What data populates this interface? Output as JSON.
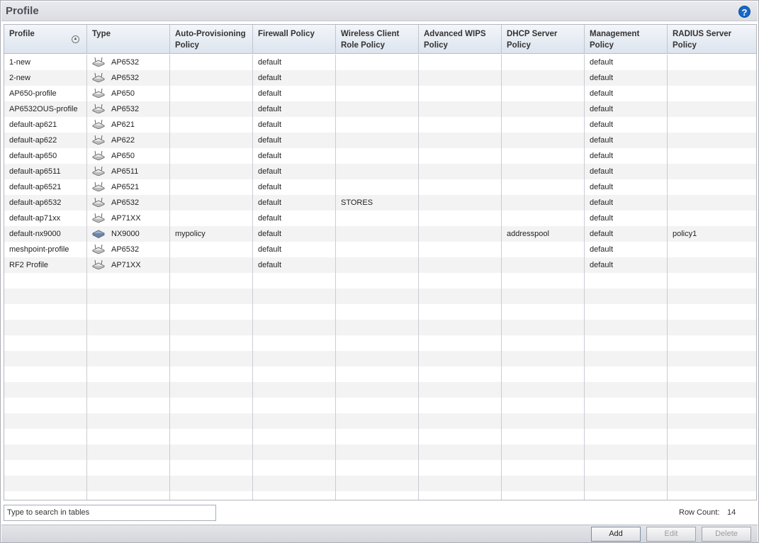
{
  "header": {
    "title": "Profile",
    "help_glyph": "?"
  },
  "table": {
    "columns": [
      "Profile",
      "Type",
      "Auto-Provisioning Policy",
      "Firewall Policy",
      "Wireless Client Role Policy",
      "Advanced WIPS Policy",
      "DHCP Server Policy",
      "Management Policy",
      "RADIUS Server Policy"
    ],
    "sort_glyph": "▲",
    "rows": [
      {
        "profile": "1-new",
        "type": "AP6532",
        "icon": "ap-icon",
        "auto": "",
        "firewall": "default",
        "wcrp": "",
        "wips": "",
        "dhcp": "",
        "mgmt": "default",
        "radius": ""
      },
      {
        "profile": "2-new",
        "type": "AP6532",
        "icon": "ap-icon",
        "auto": "",
        "firewall": "default",
        "wcrp": "",
        "wips": "",
        "dhcp": "",
        "mgmt": "default",
        "radius": ""
      },
      {
        "profile": "AP650-profile",
        "type": "AP650",
        "icon": "ap-icon",
        "auto": "",
        "firewall": "default",
        "wcrp": "",
        "wips": "",
        "dhcp": "",
        "mgmt": "default",
        "radius": ""
      },
      {
        "profile": "AP6532OUS-profile",
        "type": "AP6532",
        "icon": "ap-icon",
        "auto": "",
        "firewall": "default",
        "wcrp": "",
        "wips": "",
        "dhcp": "",
        "mgmt": "default",
        "radius": ""
      },
      {
        "profile": "default-ap621",
        "type": "AP621",
        "icon": "ap-icon",
        "auto": "",
        "firewall": "default",
        "wcrp": "",
        "wips": "",
        "dhcp": "",
        "mgmt": "default",
        "radius": ""
      },
      {
        "profile": "default-ap622",
        "type": "AP622",
        "icon": "ap-icon",
        "auto": "",
        "firewall": "default",
        "wcrp": "",
        "wips": "",
        "dhcp": "",
        "mgmt": "default",
        "radius": ""
      },
      {
        "profile": "default-ap650",
        "type": "AP650",
        "icon": "ap-icon",
        "auto": "",
        "firewall": "default",
        "wcrp": "",
        "wips": "",
        "dhcp": "",
        "mgmt": "default",
        "radius": ""
      },
      {
        "profile": "default-ap6511",
        "type": "AP6511",
        "icon": "ap-icon",
        "auto": "",
        "firewall": "default",
        "wcrp": "",
        "wips": "",
        "dhcp": "",
        "mgmt": "default",
        "radius": ""
      },
      {
        "profile": "default-ap6521",
        "type": "AP6521",
        "icon": "ap-icon",
        "auto": "",
        "firewall": "default",
        "wcrp": "",
        "wips": "",
        "dhcp": "",
        "mgmt": "default",
        "radius": ""
      },
      {
        "profile": "default-ap6532",
        "type": "AP6532",
        "icon": "ap-icon",
        "auto": "",
        "firewall": "default",
        "wcrp": "STORES",
        "wips": "",
        "dhcp": "",
        "mgmt": "default",
        "radius": ""
      },
      {
        "profile": "default-ap71xx",
        "type": "AP71XX",
        "icon": "ap-icon",
        "auto": "",
        "firewall": "default",
        "wcrp": "",
        "wips": "",
        "dhcp": "",
        "mgmt": "default",
        "radius": ""
      },
      {
        "profile": "default-nx9000",
        "type": "NX9000",
        "icon": "controller-icon",
        "auto": "mypolicy",
        "firewall": "default",
        "wcrp": "",
        "wips": "",
        "dhcp": "addresspool",
        "mgmt": "default",
        "radius": "policy1"
      },
      {
        "profile": "meshpoint-profile",
        "type": "AP6532",
        "icon": "ap-icon",
        "auto": "",
        "firewall": "default",
        "wcrp": "",
        "wips": "",
        "dhcp": "",
        "mgmt": "default",
        "radius": ""
      },
      {
        "profile": "RF2 Profile",
        "type": "AP71XX",
        "icon": "ap-icon",
        "auto": "",
        "firewall": "default",
        "wcrp": "",
        "wips": "",
        "dhcp": "",
        "mgmt": "default",
        "radius": ""
      }
    ]
  },
  "search": {
    "placeholder": "Type to search in tables"
  },
  "status": {
    "row_count_label": "Row Count:",
    "row_count": "14"
  },
  "buttons": {
    "add": "Add",
    "edit": "Edit",
    "delete": "Delete"
  }
}
